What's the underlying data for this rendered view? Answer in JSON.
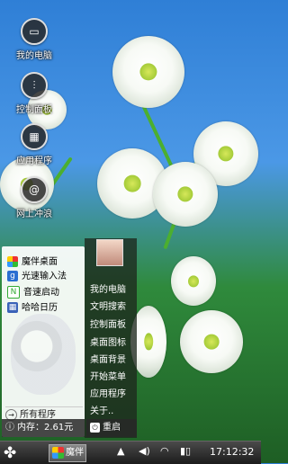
{
  "desktop": {
    "icons": [
      {
        "label": "我的电脑",
        "glyph": "▭"
      },
      {
        "label": "控制面板",
        "glyph": "⫶"
      },
      {
        "label": "应用程序",
        "glyph": "▦"
      },
      {
        "label": "网上冲浪",
        "glyph": "@"
      }
    ]
  },
  "start_menu": {
    "apps": [
      {
        "label": "魔伴桌面",
        "icon": "mobanpad-icon"
      },
      {
        "label": "光速输入法",
        "icon": "input-method-icon"
      },
      {
        "label": "音速启动",
        "icon": "quick-launch-icon"
      },
      {
        "label": "哈哈日历",
        "icon": "calendar-icon"
      }
    ],
    "all_programs": "所有程序",
    "right_items": [
      "我的电脑",
      "文明搜索",
      "控制面板",
      "桌面图标",
      "桌面背景",
      "开始菜单",
      "应用程序",
      "关于.."
    ],
    "memory_label": "内存：2.61元",
    "restart_label": "重启"
  },
  "taskbar": {
    "app_label": "魔伴",
    "clock": "17:12:32"
  }
}
